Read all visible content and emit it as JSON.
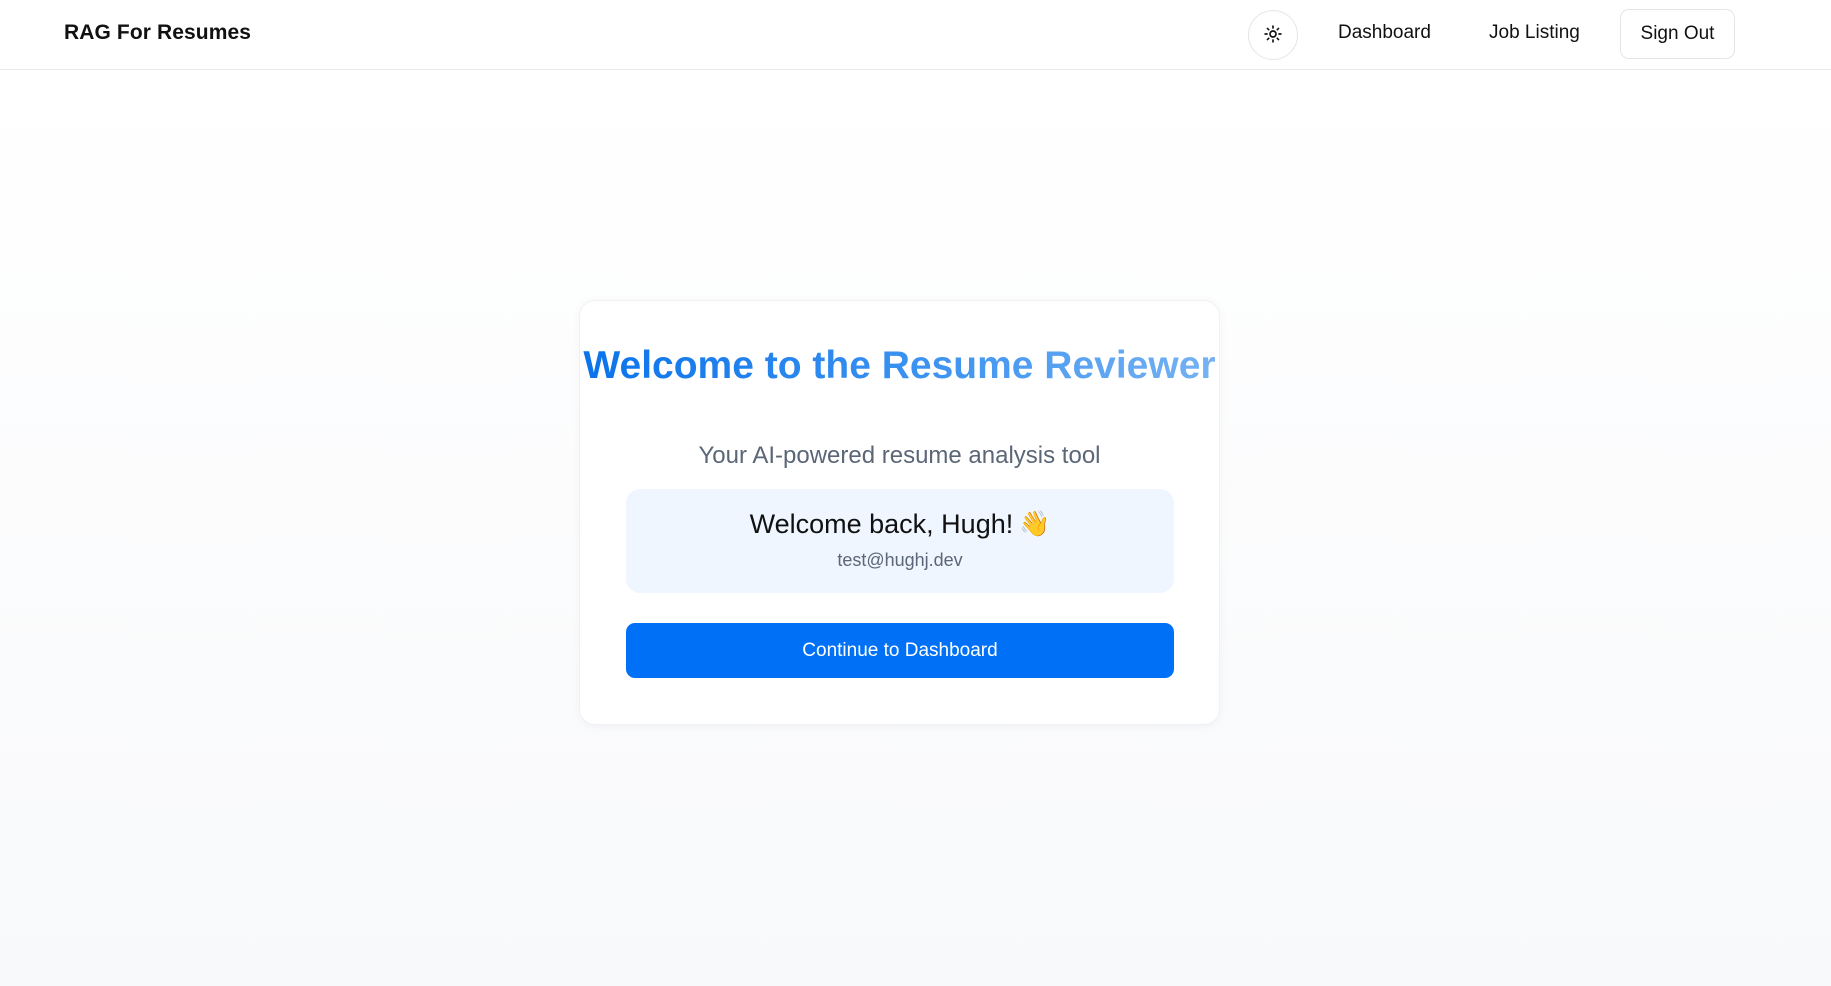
{
  "header": {
    "brand": "RAG For Resumes",
    "theme_toggle_icon": "sun-icon",
    "nav": [
      {
        "label": "Dashboard"
      },
      {
        "label": "Job Listing"
      }
    ],
    "sign_out_label": "Sign Out"
  },
  "welcome_card": {
    "title": "Welcome to the Resume Reviewer",
    "subtitle": "Your AI-powered resume analysis tool",
    "user": {
      "greeting": "Welcome back, Hugh!",
      "greeting_emoji": "👋",
      "email": "test@hughj.dev"
    },
    "cta_label": "Continue to Dashboard"
  },
  "colors": {
    "accent": "#0071f6",
    "title_gradient_start": "#0a73ea",
    "title_gradient_end": "#76b2f3",
    "user_panel_bg": "#eff6ff",
    "muted_text": "#5b6677"
  }
}
